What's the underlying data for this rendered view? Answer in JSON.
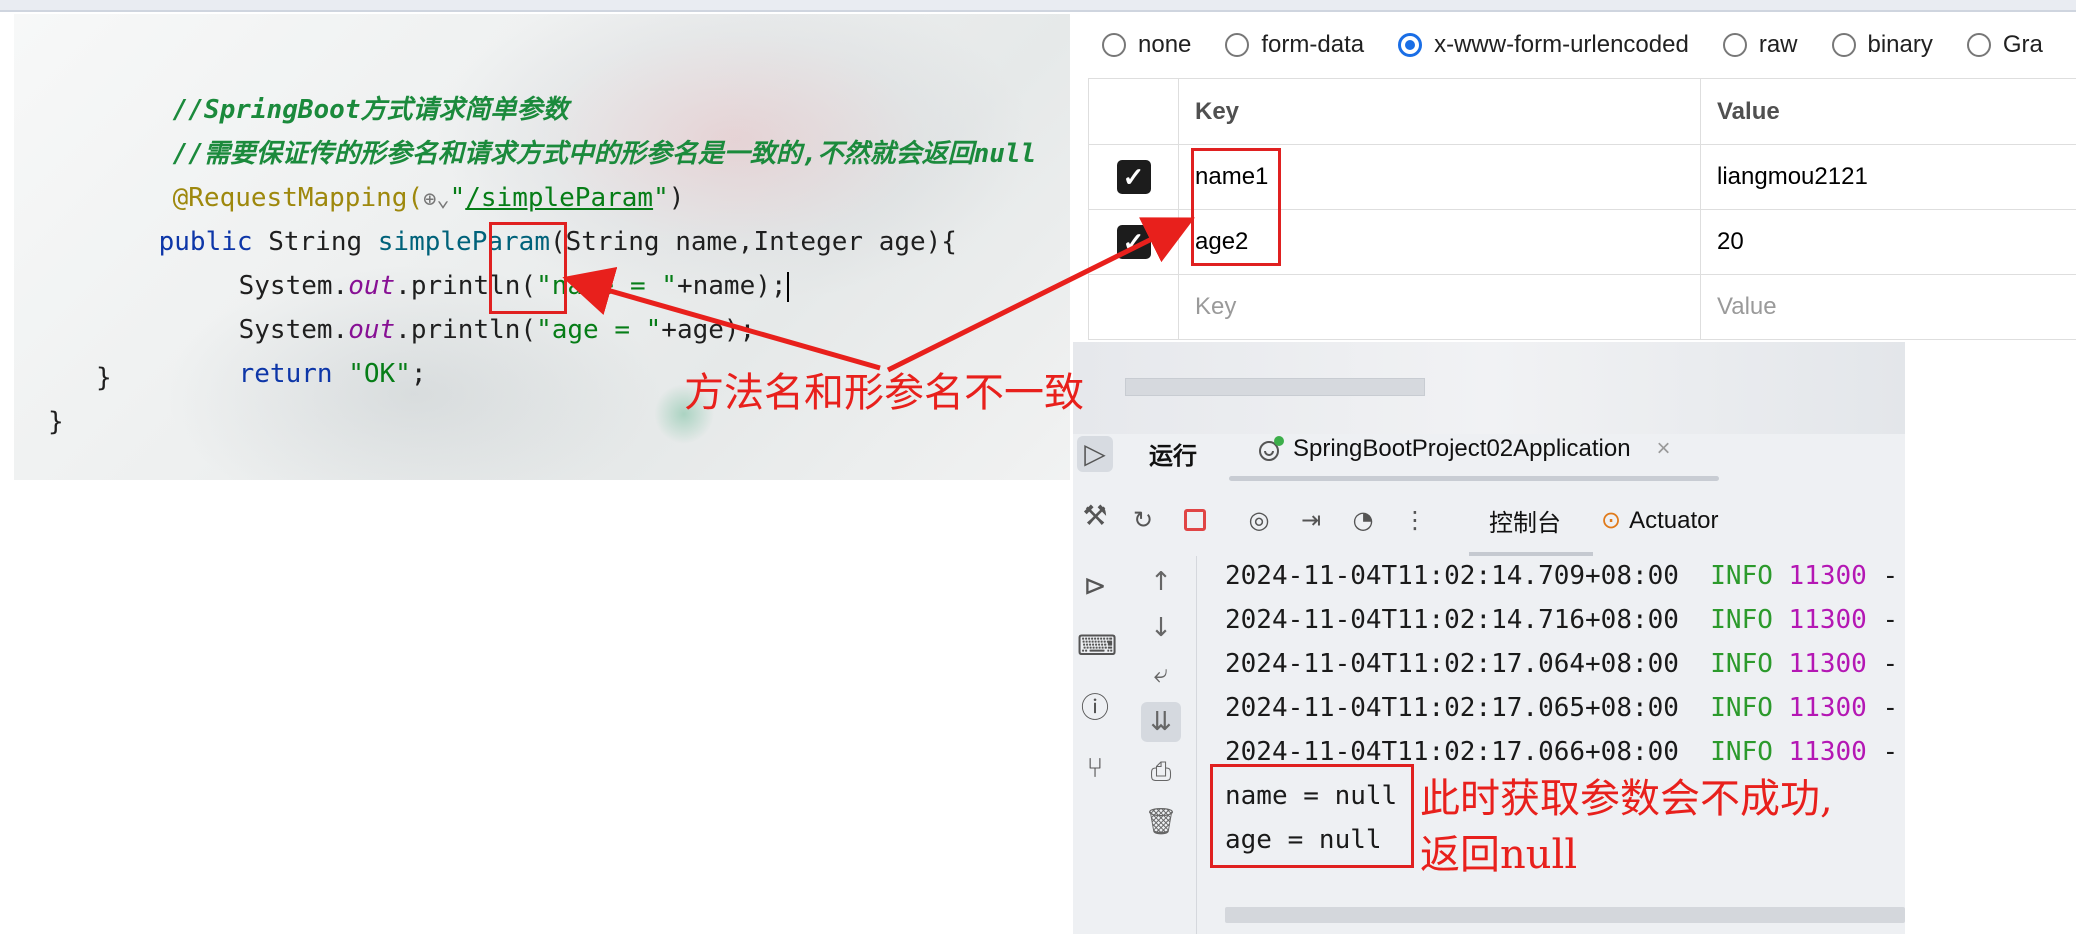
{
  "editor": {
    "comment1": "//SpringBoot方式请求简单参数",
    "comment2": "//需要保证传的形参名和请求方式中的形参名是一致的,不然就会返回null",
    "annotation": "@RequestMapping(",
    "mapping_path": "/simpleParam",
    "sig_public": "public",
    "sig_type": "String",
    "sig_method": "simpleParam",
    "sig_params": "(String name,Integer age){",
    "line1_prefix": "System.",
    "line1_field": "out",
    "line1_call": ".println(",
    "line1_str": "\"name = \"",
    "line1_rest": "+name);",
    "line2_prefix": "System.",
    "line2_field": "out",
    "line2_call": ".println(",
    "line2_str": "\"age = \"",
    "line2_rest": "+age);",
    "return_kw": "return",
    "return_val": "\"OK\"",
    "return_end": ";",
    "close_inner": "}",
    "close_outer": "}"
  },
  "annotations": {
    "mismatch_note": "方法名和形参名不一致",
    "result_note_1": "此时获取参数会不成功,",
    "result_note_2": "返回null",
    "annotation_color": "#e8201c"
  },
  "request_body": {
    "options": [
      {
        "label": "none",
        "selected": false
      },
      {
        "label": "form-data",
        "selected": false
      },
      {
        "label": "x-www-form-urlencoded",
        "selected": true
      },
      {
        "label": "raw",
        "selected": false
      },
      {
        "label": "binary",
        "selected": false
      },
      {
        "label": "Gra",
        "selected": false
      }
    ],
    "columns": {
      "key": "Key",
      "value": "Value"
    },
    "rows": [
      {
        "checked": true,
        "key": "name1",
        "value": "liangmou2121"
      },
      {
        "checked": true,
        "key": "age2",
        "value": "20"
      }
    ],
    "empty_row": {
      "key_placeholder": "Key",
      "value_placeholder": "Value"
    }
  },
  "run_panel": {
    "title": "运行",
    "tab_label": "SpringBootProject02Application",
    "close_icon": "×",
    "toolbar": {
      "console_tab": "控制台",
      "actuator_tab": "Actuator"
    },
    "log_lines": [
      {
        "time": "2024-11-04T11:02:14.709+08:00",
        "level": "INFO",
        "pid": "11300",
        "tail": "-"
      },
      {
        "time": "2024-11-04T11:02:14.716+08:00",
        "level": "INFO",
        "pid": "11300",
        "tail": "-"
      },
      {
        "time": "2024-11-04T11:02:17.064+08:00",
        "level": "INFO",
        "pid": "11300",
        "tail": "-"
      },
      {
        "time": "2024-11-04T11:02:17.065+08:00",
        "level": "INFO",
        "pid": "11300",
        "tail": "-"
      },
      {
        "time": "2024-11-04T11:02:17.066+08:00",
        "level": "INFO",
        "pid": "11300",
        "tail": "-"
      }
    ],
    "output_lines": [
      "name = null",
      "age = null"
    ]
  },
  "colors": {
    "accent_blue": "#1a6ee6",
    "log_info": "#2c9a2c",
    "log_pid": "#b417b4",
    "stop_red": "#e04545"
  }
}
